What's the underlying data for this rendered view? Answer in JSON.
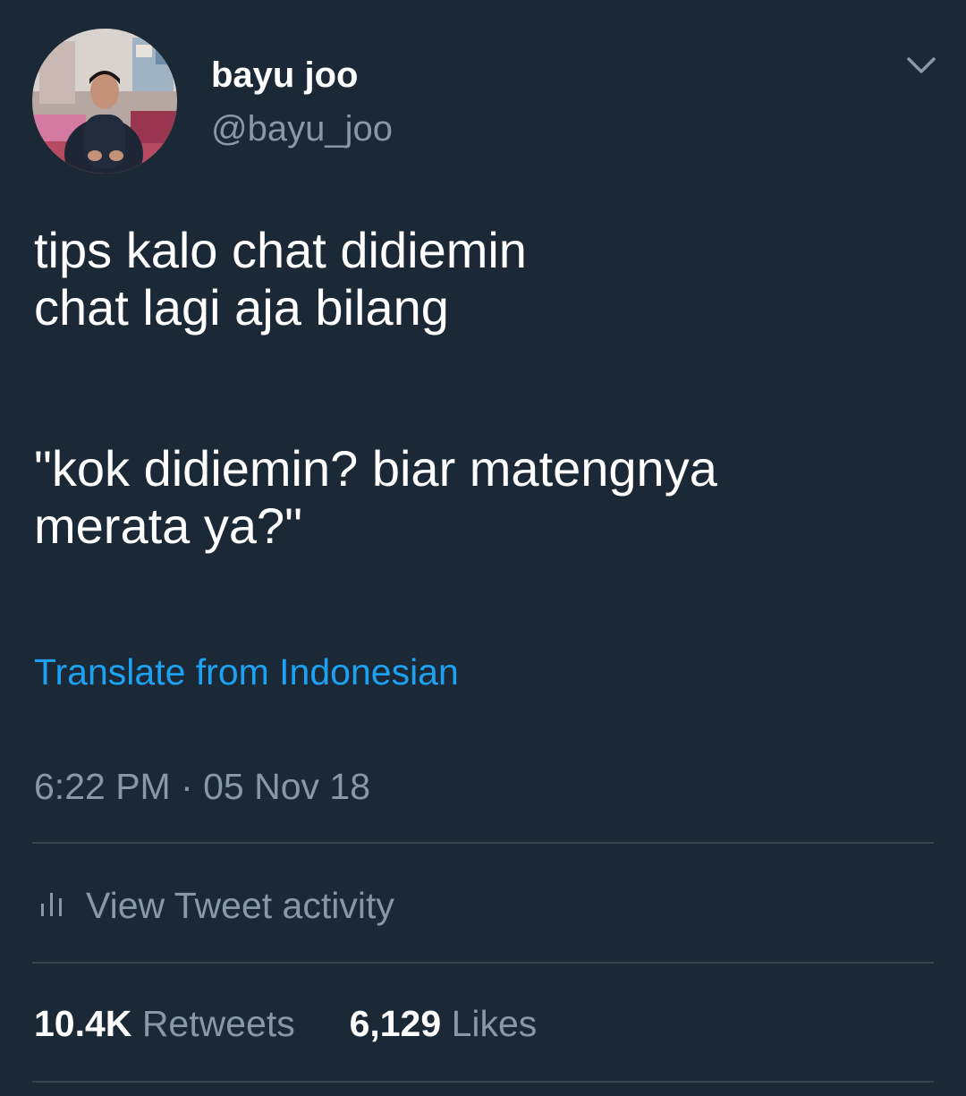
{
  "user": {
    "display_name": "bayu joo",
    "handle": "@bayu_joo"
  },
  "tweet": {
    "lines": [
      "tips kalo chat didiemin",
      "chat lagi aja bilang",
      "\"kok didiemin? biar matengnya",
      "merata ya?\""
    ],
    "translate_label": "Translate from Indonesian",
    "timestamp": "6:22 PM · 05 Nov 18"
  },
  "activity": {
    "label": "View Tweet activity"
  },
  "stats": {
    "retweets_count": "10.4K",
    "retweets_label": "Retweets",
    "likes_count": "6,129",
    "likes_label": "Likes"
  },
  "icons": {
    "more": "chevron-down-icon",
    "activity": "bar-chart-icon"
  },
  "colors": {
    "background": "#1b2836",
    "text_primary": "#ffffff",
    "text_secondary": "#8899a6",
    "link": "#1da1f2",
    "divider": "#38444d"
  }
}
